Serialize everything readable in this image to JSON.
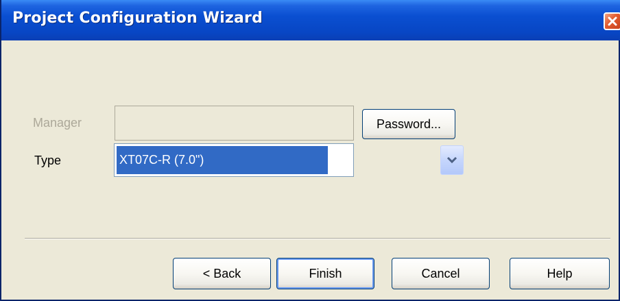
{
  "window": {
    "title": "Project Configuration Wizard"
  },
  "form": {
    "manager_label": "Manager",
    "manager_value": "",
    "password_button": "Password...",
    "type_label": "Type",
    "type_selected": "XT07C-R (7.0\")"
  },
  "footer": {
    "back_label": "< Back",
    "finish_label": "Finish",
    "cancel_label": "Cancel",
    "help_label": "Help"
  },
  "icons": {
    "close": "close-icon",
    "dropdown": "chevron-down-icon"
  },
  "colors": {
    "titlebar": "#0a4fd1",
    "selection": "#316ac5",
    "disabled_text": "#aca899",
    "close_button": "#e25b2f"
  }
}
